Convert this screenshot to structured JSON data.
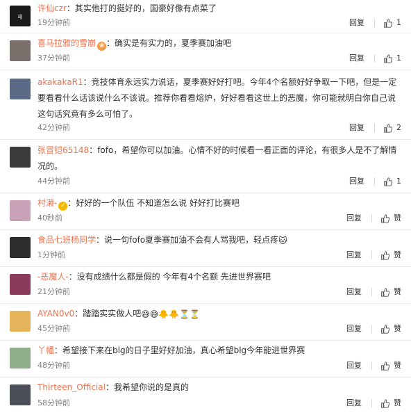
{
  "comments": [
    {
      "user": "许仙czr",
      "text": "：其实他打的挺好的，国豪好像有点菜了",
      "time": "19分钟前",
      "reply": "回复",
      "likes": "1",
      "avatar_color": "#1a1a1a"
    },
    {
      "user": "喜马拉雅的雪崩",
      "text": "：确实是有实力的，夏季赛加油吧",
      "time": "37分钟前",
      "reply": "回复",
      "likes": "1",
      "avatar_color": "#7a6f6a"
    },
    {
      "user": "akakakaR1",
      "text": "：竞技体育永远实力说话，夏季赛好好打吧。今年4个名额好好争取一下吧，但是一定要看看什么话该说什么不该说。推荐你看看熔炉，好好看看这世上的恶魔，你可能就明白你自己说这句话究竟有多么可怕了。",
      "time": "42分钟前",
      "reply": "回复",
      "likes": "2",
      "avatar_color": "#5b6a86"
    },
    {
      "user": "张冒铠65148",
      "text": "：fofo，希望你可以加油。心情不好的时候看一看正面的评论，有很多人是不了解情况的。",
      "time": "44分钟前",
      "reply": "回复",
      "likes": "1",
      "avatar_color": "#3b3b3b"
    },
    {
      "user": "村濑-",
      "text": "：好好的一个队伍 不知道怎么说 好好打比赛吧",
      "time": "40秒前",
      "reply": "回复",
      "likes": "赞",
      "avatar_color": "#c9a2b8"
    },
    {
      "user": "食品七班杨同学",
      "text": "：说一句fofo夏季赛加油不会有人骂我吧，轻点疼",
      "time": "1分钟前",
      "reply": "回复",
      "likes": "赞",
      "avatar_color": "#2d2d2d"
    },
    {
      "user": "-恶魔人-",
      "text": "：没有成绩什么都是假的 今年有4个名额 先进世界赛吧",
      "time": "21分钟前",
      "reply": "回复",
      "likes": "赞",
      "avatar_color": "#8a3a5a"
    },
    {
      "user": "AYAN0v0",
      "text": "：踏踏实实做人吧",
      "time": "45分钟前",
      "reply": "回复",
      "likes": "赞",
      "avatar_color": "#e6b45a"
    },
    {
      "user": "丫幡",
      "text": "：希望接下来在blg的日子里好好加油，真心希望blg今年能进世界赛",
      "time": "48分钟前",
      "reply": "回复",
      "likes": "赞",
      "avatar_color": "#8fae8a"
    },
    {
      "user": "Thirteen_Official",
      "text": "：我希望你说的是真的",
      "time": "58分钟前",
      "reply": "回复",
      "likes": "赞",
      "avatar_color": "#4a4f5a"
    }
  ]
}
